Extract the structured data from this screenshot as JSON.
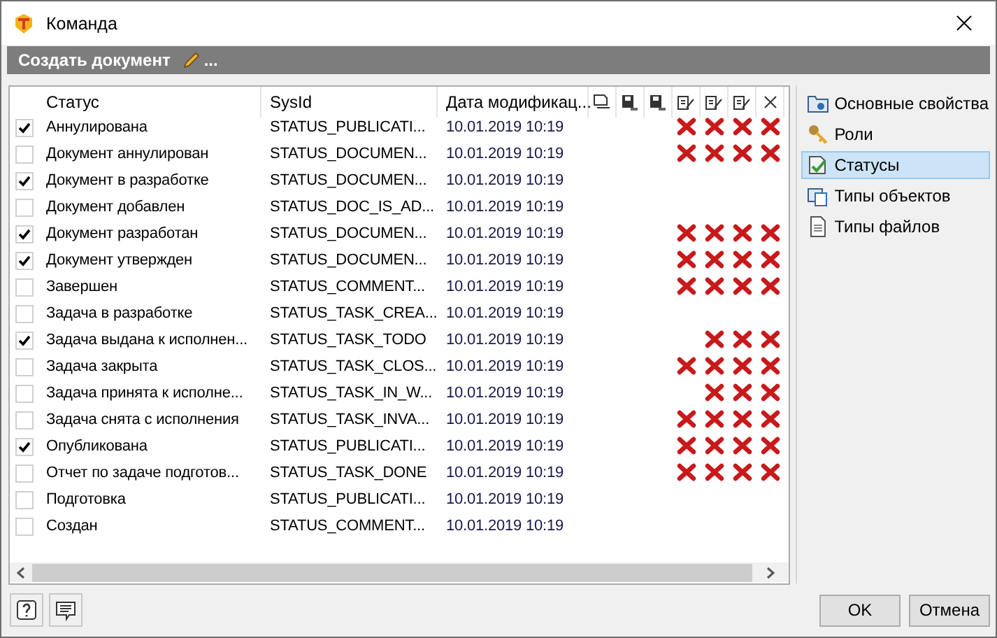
{
  "window": {
    "title": "Команда"
  },
  "command_bar": {
    "label": "Создать документ",
    "suffix": "..."
  },
  "table": {
    "columns": [
      "Статус",
      "SysId",
      "Дата модификац..."
    ],
    "rows": [
      {
        "checked": true,
        "status": "Аннулирована",
        "sysid": "STATUS_PUBLICATI...",
        "date": "10.01.2019 10:19",
        "denied": [
          false,
          false,
          false,
          true,
          true,
          true,
          true
        ]
      },
      {
        "checked": false,
        "status": "Документ аннулирован",
        "sysid": "STATUS_DOCUMEN...",
        "date": "10.01.2019 10:19",
        "denied": [
          false,
          false,
          false,
          true,
          true,
          true,
          true
        ]
      },
      {
        "checked": true,
        "status": "Документ в разработке",
        "sysid": "STATUS_DOCUMEN...",
        "date": "10.01.2019 10:19",
        "denied": [
          false,
          false,
          false,
          false,
          false,
          false,
          false
        ]
      },
      {
        "checked": false,
        "status": "Документ добавлен",
        "sysid": "STATUS_DOC_IS_AD...",
        "date": "10.01.2019 10:19",
        "denied": [
          false,
          false,
          false,
          false,
          false,
          false,
          false
        ]
      },
      {
        "checked": true,
        "status": "Документ разработан",
        "sysid": "STATUS_DOCUMEN...",
        "date": "10.01.2019 10:19",
        "denied": [
          false,
          false,
          false,
          true,
          true,
          true,
          true
        ]
      },
      {
        "checked": true,
        "status": "Документ утвержден",
        "sysid": "STATUS_DOCUMEN...",
        "date": "10.01.2019 10:19",
        "denied": [
          false,
          false,
          false,
          true,
          true,
          true,
          true
        ]
      },
      {
        "checked": false,
        "status": "Завершен",
        "sysid": "STATUS_COMMENT...",
        "date": "10.01.2019 10:19",
        "denied": [
          false,
          false,
          false,
          true,
          true,
          true,
          true
        ]
      },
      {
        "checked": false,
        "status": "Задача в разработке",
        "sysid": "STATUS_TASK_CREA...",
        "date": "10.01.2019 10:19",
        "denied": [
          false,
          false,
          false,
          false,
          false,
          false,
          false
        ]
      },
      {
        "checked": true,
        "status": "Задача выдана к исполнен...",
        "sysid": "STATUS_TASK_TODO",
        "date": "10.01.2019 10:19",
        "denied": [
          false,
          false,
          false,
          false,
          true,
          true,
          true
        ]
      },
      {
        "checked": false,
        "status": "Задача закрыта",
        "sysid": "STATUS_TASK_CLOS...",
        "date": "10.01.2019 10:19",
        "denied": [
          false,
          false,
          false,
          true,
          true,
          true,
          true
        ]
      },
      {
        "checked": false,
        "status": "Задача принята к исполне...",
        "sysid": "STATUS_TASK_IN_W...",
        "date": "10.01.2019 10:19",
        "denied": [
          false,
          false,
          false,
          false,
          true,
          true,
          true
        ]
      },
      {
        "checked": false,
        "status": "Задача снята с исполнения",
        "sysid": "STATUS_TASK_INVA...",
        "date": "10.01.2019 10:19",
        "denied": [
          false,
          false,
          false,
          true,
          true,
          true,
          true
        ]
      },
      {
        "checked": true,
        "status": "Опубликована",
        "sysid": "STATUS_PUBLICATI...",
        "date": "10.01.2019 10:19",
        "denied": [
          false,
          false,
          false,
          true,
          true,
          true,
          true
        ]
      },
      {
        "checked": false,
        "status": "Отчет по задаче подготов...",
        "sysid": "STATUS_TASK_DONE",
        "date": "10.01.2019 10:19",
        "denied": [
          false,
          false,
          false,
          true,
          true,
          true,
          true
        ]
      },
      {
        "checked": false,
        "status": "Подготовка",
        "sysid": "STATUS_PUBLICATI...",
        "date": "10.01.2019 10:19",
        "denied": [
          false,
          false,
          false,
          false,
          false,
          false,
          false
        ]
      },
      {
        "checked": false,
        "status": "Создан",
        "sysid": "STATUS_COMMENT...",
        "date": "10.01.2019 10:19",
        "denied": [
          false,
          false,
          false,
          false,
          false,
          false,
          false
        ]
      }
    ]
  },
  "sidebar": {
    "items": [
      {
        "label": "Основные свойства",
        "selected": false
      },
      {
        "label": "Роли",
        "selected": false
      },
      {
        "label": "Статусы",
        "selected": true
      },
      {
        "label": "Типы объектов",
        "selected": false
      },
      {
        "label": "Типы файлов",
        "selected": false
      }
    ]
  },
  "buttons": [
    "OK",
    "Отмена"
  ]
}
